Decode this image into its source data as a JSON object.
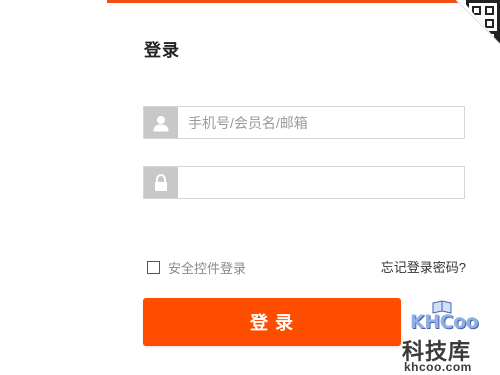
{
  "login": {
    "title": "登录",
    "username": {
      "placeholder": "手机号/会员名/邮箱",
      "value": "",
      "icon": "user-icon"
    },
    "password": {
      "placeholder": "",
      "value": "",
      "icon": "lock-icon"
    },
    "secure_control_label": "安全控件登录",
    "forgot_password_label": "忘记登录密码?",
    "submit_label": "登 录"
  },
  "qr_toggle": {
    "icon": "qr-code-icon"
  },
  "watermark": {
    "logo_text": "KHCoo",
    "name": "科技库",
    "url": "khcoo.com"
  },
  "colors": {
    "accent": "#ff4d00",
    "top_line": "#f24d12",
    "icon_bg": "#c8c8c8",
    "border": "#d6d6d6"
  }
}
